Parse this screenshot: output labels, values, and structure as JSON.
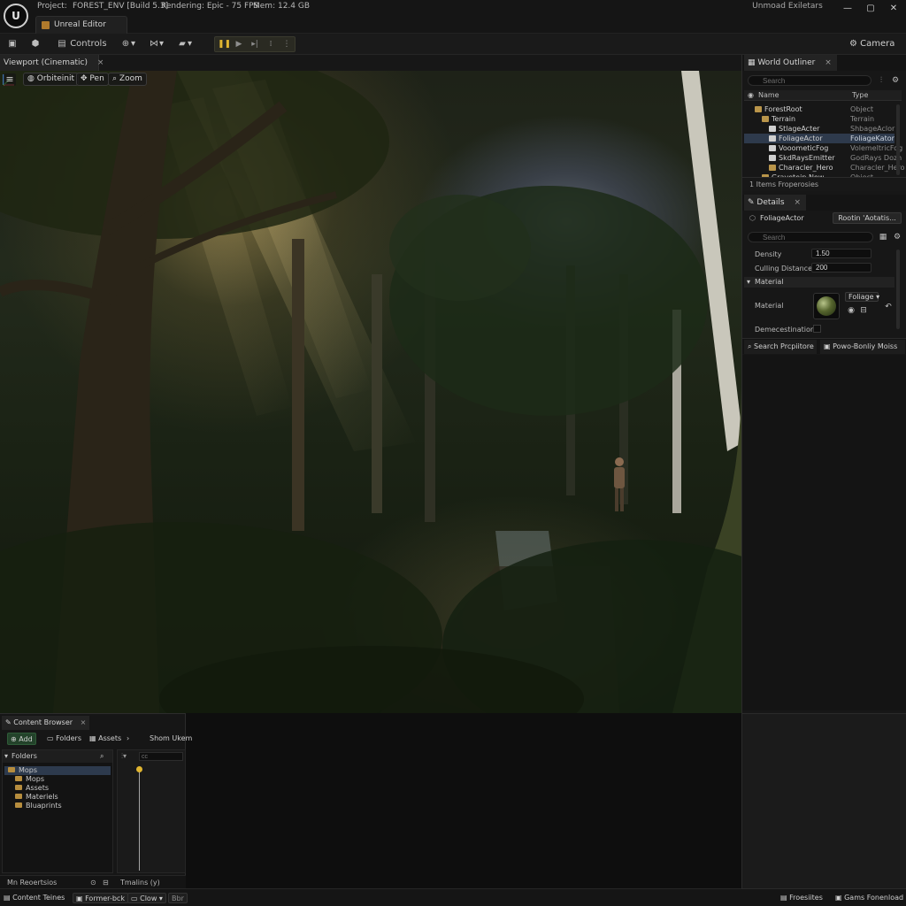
{
  "titlebar": {
    "project_label": "Project:",
    "project_name": "FOREST_ENV [Build 5.3]",
    "rendering": "Rendering: Epic - 75 FPS",
    "memory": "Mem: 12.4 GB",
    "promo": "Unmoad Exiletars",
    "window_tab": "Unreal Editor",
    "logo": "U"
  },
  "toolbar": {
    "controls_label": "Controls",
    "camera_label": "Camera"
  },
  "viewport": {
    "tab_label": "Viewport (Cinematic)",
    "orbit_label": "Orbiteinit",
    "pan_label": "Pen",
    "zoom_label": "Zoom"
  },
  "outliner": {
    "tab_label": "World Outliner",
    "search_placeholder": "Search",
    "col_name": "Name",
    "col_type": "Type",
    "rows": [
      {
        "name": "ForestRoot",
        "type": "Object",
        "indent": 1,
        "color": "#b9954a",
        "selected": false
      },
      {
        "name": "Terrain",
        "type": "Terrain",
        "indent": 2,
        "color": "#b9954a",
        "selected": false
      },
      {
        "name": "StlageActer",
        "type": "ShbageAclor",
        "indent": 3,
        "color": "#cfcfcf",
        "selected": false
      },
      {
        "name": "FoliageActor",
        "type": "FoliageKator",
        "indent": 3,
        "color": "#cfcfcf",
        "selected": true
      },
      {
        "name": "VooometicFog",
        "type": "VolemeltricFog",
        "indent": 3,
        "color": "#cfcfcf",
        "selected": false
      },
      {
        "name": "SkdRaysEmitter",
        "type": "GodRays Dozh",
        "indent": 3,
        "color": "#cfcfcf",
        "selected": false
      },
      {
        "name": "Characler_Hero",
        "type": "Characler_Hero",
        "indent": 3,
        "color": "#b9954a",
        "selected": false
      },
      {
        "name": "Gravetein New",
        "type": "Object",
        "indent": 2,
        "color": "#b9954a",
        "selected": false
      }
    ],
    "footer": "1 Items Froperosies"
  },
  "details": {
    "tab_label": "Details",
    "actor_name": "FoliageActor",
    "actor_button": "Rootin 'Aotatis...",
    "search_placeholder": "Search",
    "props": [
      {
        "label": "Density",
        "value": "1.50"
      },
      {
        "label": "Culling Distance",
        "value": "200"
      }
    ],
    "section_material": "Material",
    "material_label": "Material",
    "material_select": "Foliage",
    "more_label": "Demecestination",
    "bottom_tab_1": "Search Prcpiitore",
    "bottom_tab_2": "Powo-Bonliy Moiss"
  },
  "right_status": {
    "item1": "Froesiites",
    "item2": "Gams Fonenload"
  },
  "content_browser": {
    "tab_label": "Content Browser",
    "add_label": "Add",
    "folders_btn": "Folders",
    "assets_btn": "Assets",
    "show_item": "Shom Ukem",
    "folders_header": "Folders",
    "filter_placeholder": "cc",
    "folders": [
      {
        "name": "Mops",
        "indent": 0,
        "selected": true
      },
      {
        "name": "Mops",
        "indent": 1,
        "selected": false
      },
      {
        "name": "Assets",
        "indent": 1,
        "selected": false
      },
      {
        "name": "Materiels",
        "indent": 1,
        "selected": false
      },
      {
        "name": "Bluaprints",
        "indent": 1,
        "selected": false
      }
    ],
    "footer_left": "Mn Reoertsios",
    "footer_right": "Tmalins (y)"
  },
  "status_bar": {
    "item1": "Content Teines",
    "item2": "Former-bck",
    "item3": "Clow",
    "item4": "Bbr"
  },
  "colors": {
    "accent_selection": "#2e3a4c",
    "folder": "#b68d3e",
    "add_button": "#23422a"
  }
}
